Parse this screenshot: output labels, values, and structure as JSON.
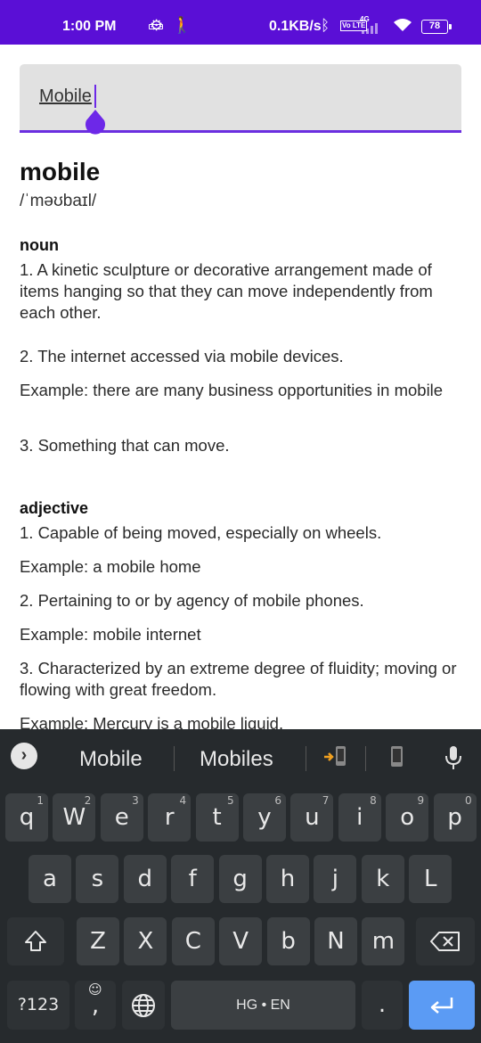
{
  "status_bar": {
    "time": "1:00 PM",
    "speed": "0.1KB/s",
    "network": "4G",
    "volte": "Vo LTE",
    "battery": "78"
  },
  "search": {
    "value": "Mobile"
  },
  "entry": {
    "word": "mobile",
    "phonetic": "/ˈməʊbaɪl/",
    "noun": {
      "label": "noun",
      "def1": "1. A kinetic sculpture or decorative arrangement made of items hanging so that they can move independently from each other.",
      "def2": "2. The internet accessed via mobile devices.",
      "ex2": "Example: there are many business opportunities in mobile",
      "def3": "3. Something that can move."
    },
    "adjective": {
      "label": "adjective",
      "def1": "1. Capable of being moved, especially on wheels.",
      "ex1": "Example: a mobile home",
      "def2": "2. Pertaining to or by agency of mobile phones.",
      "ex2": "Example: mobile internet",
      "def3": "3. Characterized by an extreme degree of fluidity; moving or flowing with great freedom.",
      "ex3": "Example: Mercury is a mobile liquid."
    }
  },
  "keyboard": {
    "suggestions": [
      "Mobile",
      "Mobiles"
    ],
    "row1": [
      {
        "k": "q",
        "h": "1"
      },
      {
        "k": "w",
        "h": "2"
      },
      {
        "k": "e",
        "h": "3"
      },
      {
        "k": "r",
        "h": "4"
      },
      {
        "k": "t",
        "h": "5"
      },
      {
        "k": "y",
        "h": "6"
      },
      {
        "k": "u",
        "h": "7"
      },
      {
        "k": "i",
        "h": "8"
      },
      {
        "k": "o",
        "h": "9"
      },
      {
        "k": "p",
        "h": "0"
      }
    ],
    "row2": [
      "a",
      "s",
      "d",
      "f",
      "g",
      "h",
      "j",
      "k",
      "l"
    ],
    "row3": [
      "z",
      "x",
      "c",
      "v",
      "b",
      "n",
      "m"
    ],
    "symbols_label": "?123",
    "comma": ",",
    "period": ".",
    "space_label": "HG • EN"
  }
}
